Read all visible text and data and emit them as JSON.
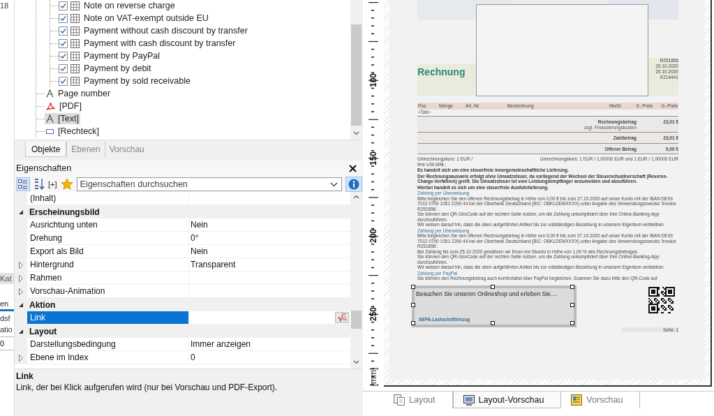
{
  "side_panel": {
    "top_label": "18",
    "items": [
      {
        "kind": "tab",
        "label": "Kat",
        "selected": false
      },
      {
        "kind": "tab",
        "label": "en",
        "selected": true
      },
      {
        "kind": "text",
        "label": "dsf"
      },
      {
        "kind": "text",
        "label": "atio"
      },
      {
        "kind": "field",
        "label": "0"
      }
    ]
  },
  "tree": {
    "items": [
      {
        "children": [
          {
            "label": "Note on reverse charge",
            "kind": "table",
            "checked": true,
            "selected": false
          },
          {
            "label": "Note on VAT-exempt outside EU",
            "kind": "table",
            "checked": true,
            "selected": false
          },
          {
            "label": "Payment without cash discount by transfer",
            "kind": "table",
            "checked": true,
            "selected": false
          },
          {
            "label": "Payment with cash discount by transfer",
            "kind": "table",
            "checked": true,
            "selected": false
          },
          {
            "label": "Payment by PayPal",
            "kind": "table",
            "checked": true,
            "selected": false
          },
          {
            "label": "Payment by debit",
            "kind": "table",
            "checked": true,
            "selected": false
          },
          {
            "label": "Payment by sold receivable",
            "kind": "table",
            "checked": true,
            "selected": false
          }
        ]
      },
      {
        "label": "Page number",
        "kind": "text",
        "selected": false
      },
      {
        "label": "[PDF]",
        "kind": "pdf",
        "selected": false
      },
      {
        "label": "[Text]",
        "kind": "text",
        "selected": true
      },
      {
        "label": "[Rechteck]",
        "kind": "rect",
        "selected": false
      }
    ]
  },
  "tabs": [
    {
      "label": "Objekte",
      "selected": true
    },
    {
      "label": "Ebenen",
      "selected": false
    },
    {
      "label": "Vorschau",
      "selected": false
    }
  ],
  "properties": {
    "title": "Eigenschaften",
    "toolbar_label": "[+]",
    "search": {
      "placeholder": "Eigenschaften durchsuchen"
    },
    "rows": [
      {
        "kind": "property",
        "name": "(Inhalt)",
        "selected": false
      },
      {
        "kind": "category",
        "name": "Erscheinungsbild",
        "expanded": true
      },
      {
        "kind": "property",
        "name": "Ausrichtung unten",
        "value": "Nein",
        "selected": false
      },
      {
        "kind": "property",
        "name": "Drehung",
        "value": "0°",
        "selected": false
      },
      {
        "kind": "property",
        "name": "Export als Bild",
        "value": "Nein",
        "selected": false
      },
      {
        "kind": "property",
        "name": "Hintergrund",
        "value": "Transparent",
        "expanded": false,
        "selected": false
      },
      {
        "kind": "property",
        "name": "Rahmen",
        "expanded": false,
        "selected": false
      },
      {
        "kind": "property",
        "name": "Vorschau-Animation",
        "expanded": false,
        "selected": false
      },
      {
        "kind": "category",
        "name": "Aktion",
        "expanded": true
      },
      {
        "kind": "formula",
        "name": "Link",
        "selected": true
      },
      {
        "kind": "category",
        "name": "Layout",
        "expanded": true
      },
      {
        "kind": "property",
        "name": "Darstellungsbedingung",
        "value": "Immer anzeigen",
        "selected": false
      },
      {
        "kind": "property",
        "name": "Ebene im Index",
        "value": "0",
        "expanded": false,
        "selected": false
      }
    ],
    "description": {
      "title": "Link",
      "text": "Link, der bei Klick aufgerufen wird (nur bei Vorschau und PDF-Export)."
    }
  },
  "ruler": {
    "labels": [
      "100",
      "150",
      "200",
      "250"
    ],
    "unit": "[mm]"
  },
  "preview": {
    "title": "Rechnung",
    "meta": [
      "R251856",
      "20.10.2020",
      "20.10.2020",
      "K214441"
    ],
    "columns": [
      "Pos.",
      "Menge",
      "Art.-Nr.",
      "Bezeichnung",
      "MwSt.",
      "E.-Preis",
      "G.-Preis"
    ],
    "row_marker": "<Tab>",
    "totals": [
      {
        "label": "Rechnungsbetrag",
        "value": "23,01 €",
        "note": "zzgl. Finanzierungskosten"
      },
      {
        "label": "Zahlbetrag",
        "value": "23,01 €"
      },
      {
        "label": "Offener Betrag",
        "value": "0,00 €"
      }
    ],
    "exchange_left": "Umrechnungskurs: 1 EUR /",
    "exchange_right": "Umrechnungskurs: 1 EUR / 1,00000 EUR und 1 EUR / 1,00000 EUR",
    "blocks": [
      {
        "kind": "plain",
        "text": "Ihre USt-IdNr.:"
      },
      {
        "kind": "bold",
        "text": "Es handelt sich um eine steuerfreie innergemeinschaftliche Lieferung."
      },
      {
        "kind": "bold",
        "text": "Der Rechnungsausweis erfolgt ohne Umsatzsteuer, da vorliegend der Wechsel der Steuerschuldnerschaft (Reverse-Charge-Verfahren) greift. Die Umsatzsteuer ist vom Leistungsempfänger anzumelden und abzuführen."
      },
      {
        "kind": "bold",
        "text": "Hierbei handelt es sich um eine steuerfreie Ausfuhrlieferung."
      },
      {
        "kind": "heading",
        "text": "Zahlung per Überweisung"
      },
      {
        "kind": "plain",
        "text": "Bitte begleichen Sie den offenen Rechnungsbetrag in Höhe von 0,00 € bis zum 27.10.2020 auf unser Konto mit der IBAN DE09 7012 0700 1051 2290 44 bei der Oberbank Deutschland (BIC: OBKLDEMXXXX) unter Angabe des Verwendungszwecks 'Invoice R251856'."
      },
      {
        "kind": "plain",
        "text": "Sie können den QR-GiroCode auf der rechten Seite nutzen, um die Zahlung unkompliziert über Ihre Online-Banking-App durchzuführen."
      },
      {
        "kind": "plain",
        "text": "Wir weisen darauf hin, dass die oben aufgeführten Artikel bis zur vollständigen Bezahlung in unserem Eigentum verbleiben."
      },
      {
        "kind": "heading",
        "text": "Zahlung per Überweisung"
      },
      {
        "kind": "plain",
        "text": "Bitte begleichen Sie den offenen Rechnungsbetrag in Höhe von 0,00 € bis zum 27.10.2020 auf unser Konto mit der IBAN DE09 7012 0700 1051 2290 44 bei der Oberbank Deutschland (BIC: OBKLDEMXXXX) unter Angabe des Verwendungszwecks 'Invoice R251856'."
      },
      {
        "kind": "plain",
        "text": "Bei Zahlung bis zum 25.10.2020 gewähren wir Ihnen ein Skonto in Höhe von 1,00 % des Rechnungsbetrages."
      },
      {
        "kind": "plain",
        "text": "Sie können den QR-GiroCode auf der rechten Seite nutzen, um die Zahlung unkompliziert über Ihre Online-Banking-App durchzuführen."
      },
      {
        "kind": "plain",
        "text": "Wir weisen darauf hin, dass die oben aufgeführten Artikel bis zur vollständigen Bezahlung in unserem Eigentum verbleiben."
      },
      {
        "kind": "heading",
        "text": "Zahlung per PayPal"
      },
      {
        "kind": "plain",
        "text": "Sie können den Rechnungsbetrag auch komfortabel über PayPal begleichen. Scannen Sie dazu bitte den QR-Code auf"
      }
    ],
    "selected_box": {
      "text": "Besuchen Sie unseren Onlineshop und erleben Sie....",
      "behind": "SEPA-Lastschrifteinzug"
    },
    "page_label": "Seite: 1"
  },
  "view_tabs": [
    {
      "label": "Layout",
      "kind": "layout",
      "selected": false
    },
    {
      "label": "Layout-Vorschau",
      "kind": "layout-preview",
      "selected": true
    },
    {
      "label": "Vorschau",
      "kind": "preview",
      "selected": false
    }
  ]
}
